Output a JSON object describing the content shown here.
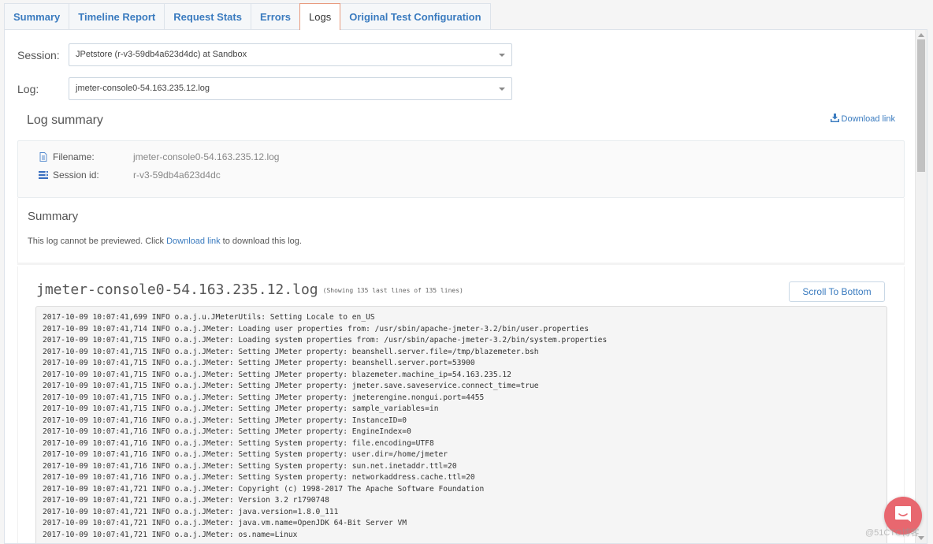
{
  "tabs": [
    {
      "label": "Summary",
      "active": false
    },
    {
      "label": "Timeline Report",
      "active": false
    },
    {
      "label": "Request Stats",
      "active": false
    },
    {
      "label": "Errors",
      "active": false
    },
    {
      "label": "Logs",
      "active": true
    },
    {
      "label": "Original Test Configuration",
      "active": false
    }
  ],
  "form": {
    "session_label": "Session:",
    "session_value": "JPetstore (r-v3-59db4a623d4dc) at Sandbox",
    "log_label": "Log:",
    "log_value": "jmeter-console0-54.163.235.12.log"
  },
  "log_summary": {
    "title": "Log summary",
    "download_label": "Download link",
    "filename_label": "Filename:",
    "filename_value": "jmeter-console0-54.163.235.12.log",
    "session_id_label": "Session id:",
    "session_id_value": "r-v3-59db4a623d4dc"
  },
  "summary": {
    "title": "Summary",
    "text_before": "This log cannot be previewed. Click ",
    "link_text": "Download link",
    "text_after": " to download this log."
  },
  "log_viewer": {
    "title": "jmeter-console0-54.163.235.12.log",
    "subtitle": "(Showing 135 last lines of 135 lines)",
    "scroll_button": "Scroll To Bottom",
    "lines": [
      "2017-10-09 10:07:41,699 INFO o.a.j.u.JMeterUtils: Setting Locale to en_US",
      "2017-10-09 10:07:41,714 INFO o.a.j.JMeter: Loading user properties from: /usr/sbin/apache-jmeter-3.2/bin/user.properties",
      "2017-10-09 10:07:41,715 INFO o.a.j.JMeter: Loading system properties from: /usr/sbin/apache-jmeter-3.2/bin/system.properties",
      "2017-10-09 10:07:41,715 INFO o.a.j.JMeter: Setting JMeter property: beanshell.server.file=/tmp/blazemeter.bsh",
      "2017-10-09 10:07:41,715 INFO o.a.j.JMeter: Setting JMeter property: beanshell.server.port=53900",
      "2017-10-09 10:07:41,715 INFO o.a.j.JMeter: Setting JMeter property: blazemeter.machine_ip=54.163.235.12",
      "2017-10-09 10:07:41,715 INFO o.a.j.JMeter: Setting JMeter property: jmeter.save.saveservice.connect_time=true",
      "2017-10-09 10:07:41,715 INFO o.a.j.JMeter: Setting JMeter property: jmeterengine.nongui.port=4455",
      "2017-10-09 10:07:41,715 INFO o.a.j.JMeter: Setting JMeter property: sample_variables=in",
      "2017-10-09 10:07:41,716 INFO o.a.j.JMeter: Setting JMeter property: InstanceID=0",
      "2017-10-09 10:07:41,716 INFO o.a.j.JMeter: Setting JMeter property: EngineIndex=0",
      "2017-10-09 10:07:41,716 INFO o.a.j.JMeter: Setting System property: file.encoding=UTF8",
      "2017-10-09 10:07:41,716 INFO o.a.j.JMeter: Setting System property: user.dir=/home/jmeter",
      "2017-10-09 10:07:41,716 INFO o.a.j.JMeter: Setting System property: sun.net.inetaddr.ttl=20",
      "2017-10-09 10:07:41,716 INFO o.a.j.JMeter: Setting System property: networkaddress.cache.ttl=20",
      "2017-10-09 10:07:41,721 INFO o.a.j.JMeter: Copyright (c) 1998-2017 The Apache Software Foundation",
      "2017-10-09 10:07:41,721 INFO o.a.j.JMeter: Version 3.2 r1790748",
      "2017-10-09 10:07:41,721 INFO o.a.j.JMeter: java.version=1.8.0_111",
      "2017-10-09 10:07:41,721 INFO o.a.j.JMeter: java.vm.name=OpenJDK 64-Bit Server VM",
      "2017-10-09 10:07:41,721 INFO o.a.j.JMeter: os.name=Linux"
    ]
  },
  "icons": {
    "file": "file-icon",
    "session": "list-icon",
    "download": "download-icon",
    "chat": "chat-icon"
  },
  "watermark": "@51CTO博客",
  "colors": {
    "accent": "#3a7bbf",
    "active_tab_border": "#e89a7e",
    "chat_bubble": "#e8676f"
  }
}
